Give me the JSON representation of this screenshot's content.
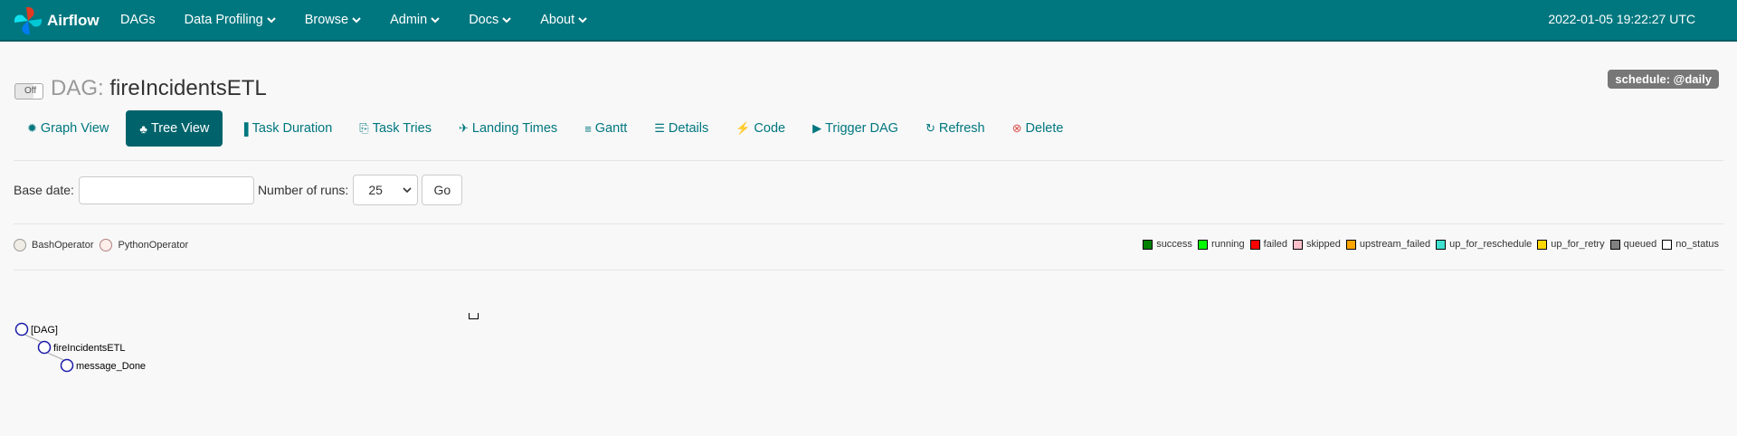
{
  "navbar": {
    "brand": "Airflow",
    "items": [
      {
        "label": "DAGs",
        "has_caret": false
      },
      {
        "label": "Data Profiling",
        "has_caret": true
      },
      {
        "label": "Browse",
        "has_caret": true
      },
      {
        "label": "Admin",
        "has_caret": true
      },
      {
        "label": "Docs",
        "has_caret": true
      },
      {
        "label": "About",
        "has_caret": true
      }
    ],
    "clock": "2022-01-05 19:22:27 UTC"
  },
  "dag": {
    "toggle_label": "Off",
    "prefix": "DAG:",
    "name": "fireIncidentsETL",
    "schedule": "schedule: @daily"
  },
  "tabs": [
    {
      "label": "Graph View",
      "icon": "asterisk-icon",
      "active": false
    },
    {
      "label": "Tree View",
      "icon": "tree-icon",
      "active": true
    },
    {
      "label": "Task Duration",
      "icon": "bar-chart-icon",
      "active": false
    },
    {
      "label": "Task Tries",
      "icon": "copy-icon",
      "active": false
    },
    {
      "label": "Landing Times",
      "icon": "plane-icon",
      "active": false
    },
    {
      "label": "Gantt",
      "icon": "gantt-icon",
      "active": false
    },
    {
      "label": "Details",
      "icon": "list-icon",
      "active": false
    },
    {
      "label": "Code",
      "icon": "flash-icon",
      "active": false
    },
    {
      "label": "Trigger DAG",
      "icon": "play-circle-icon",
      "active": false
    },
    {
      "label": "Refresh",
      "icon": "refresh-icon",
      "active": false
    },
    {
      "label": "Delete",
      "icon": "remove-circle-icon",
      "active": false
    }
  ],
  "form": {
    "base_date_label": "Base date:",
    "base_date_value": "",
    "runs_label": "Number of runs:",
    "runs_value": "25",
    "go_label": "Go"
  },
  "operators": [
    {
      "label": "BashOperator",
      "color": "#f0ede4",
      "border": "#999"
    },
    {
      "label": "PythonOperator",
      "color": "#ffefeb",
      "border": "#b08080"
    }
  ],
  "states": [
    {
      "label": "success",
      "color": "#008000"
    },
    {
      "label": "running",
      "color": "#00ff00"
    },
    {
      "label": "failed",
      "color": "#ff0000"
    },
    {
      "label": "skipped",
      "color": "#ffc0cb"
    },
    {
      "label": "upstream_failed",
      "color": "#ffa500"
    },
    {
      "label": "up_for_reschedule",
      "color": "#40e0d0"
    },
    {
      "label": "up_for_retry",
      "color": "#ffd700"
    },
    {
      "label": "queued",
      "color": "#808080"
    },
    {
      "label": "no_status",
      "color": "#ffffff"
    }
  ],
  "tree": {
    "nodes": [
      {
        "label": "[DAG]",
        "level": 0
      },
      {
        "label": "fireIncidentsETL",
        "level": 1
      },
      {
        "label": "message_Done",
        "level": 2
      }
    ]
  }
}
